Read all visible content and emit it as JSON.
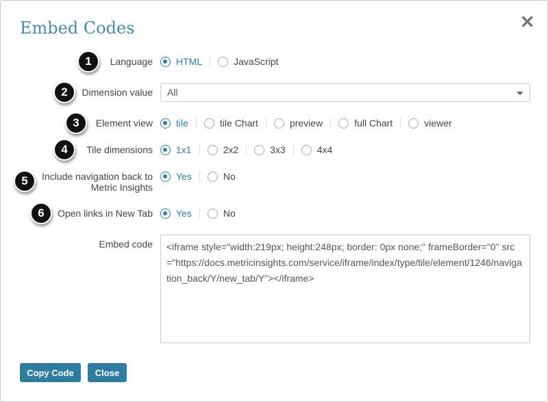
{
  "title": "Embed Codes",
  "rows": {
    "language": {
      "label": "Language",
      "options": [
        "HTML",
        "JavaScript"
      ],
      "selected": "HTML"
    },
    "dimension": {
      "label": "Dimension value",
      "value": "All"
    },
    "element_view": {
      "label": "Element view",
      "options": [
        "tile",
        "tile Chart",
        "preview",
        "full Chart",
        "viewer"
      ],
      "selected": "tile"
    },
    "tile_dims": {
      "label": "Tile dimensions",
      "options": [
        "1x1",
        "2x2",
        "3x3",
        "4x4"
      ],
      "selected": "1x1"
    },
    "nav_back": {
      "label": "Include navigation back to Metric Insights",
      "options": [
        "Yes",
        "No"
      ],
      "selected": "Yes"
    },
    "new_tab": {
      "label": "Open links in New Tab",
      "options": [
        "Yes",
        "No"
      ],
      "selected": "Yes"
    },
    "embed": {
      "label": "Embed code",
      "value": "<iframe style=\"width:219px; height:248px; border: 0px none;\" frameBorder=\"0\" src=\"https://docs.metricinsights.com/service/iframe/index/type/tile/element/1246/navigation_back/Y/new_tab/Y\"></iframe>"
    }
  },
  "badges": [
    "1",
    "2",
    "3",
    "4",
    "5",
    "6"
  ],
  "buttons": {
    "copy": "Copy Code",
    "close": "Close"
  },
  "colors": {
    "accent": "#2f7fa5",
    "button": "#2e7d9e",
    "title": "#4a88a8"
  }
}
